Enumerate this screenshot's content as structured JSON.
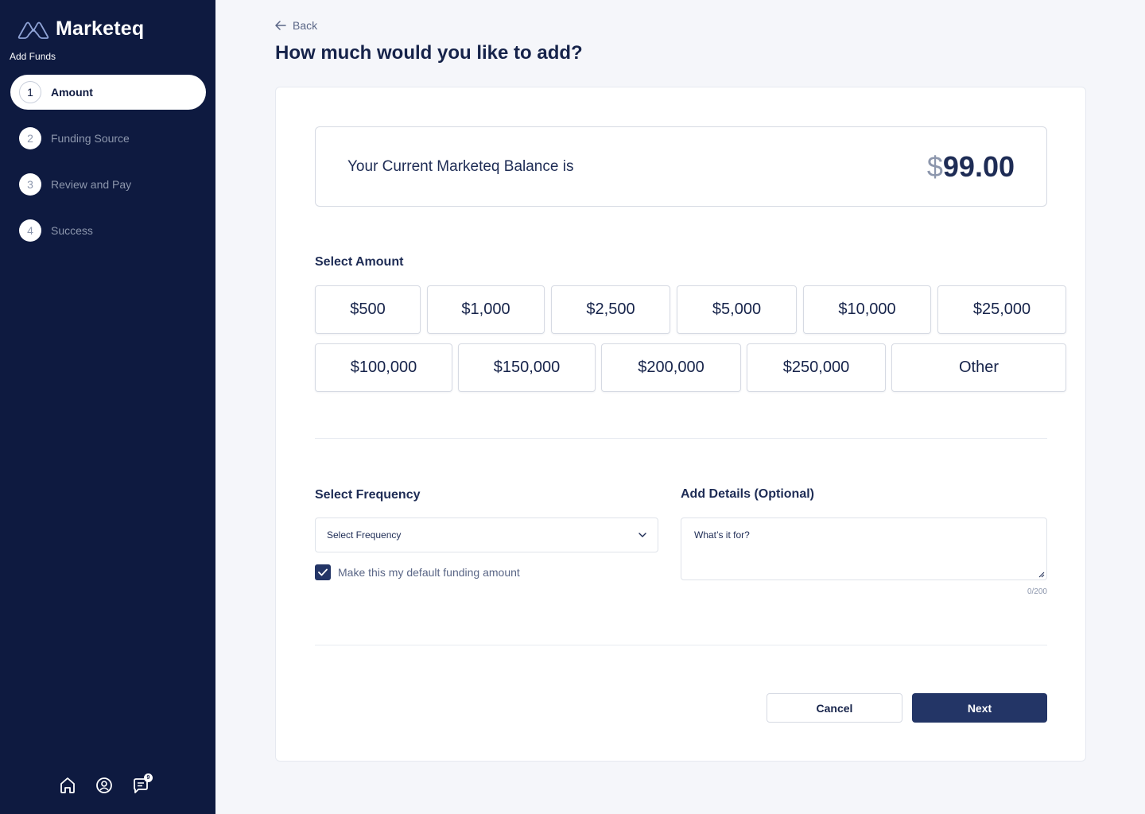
{
  "sidebar": {
    "brand": "Marketeq",
    "section_label": "Add Funds",
    "steps": [
      {
        "num": "1",
        "label": "Amount"
      },
      {
        "num": "2",
        "label": "Funding Source"
      },
      {
        "num": "3",
        "label": "Review and Pay"
      },
      {
        "num": "4",
        "label": "Success"
      }
    ],
    "messages_badge": "9"
  },
  "header": {
    "back_label": "Back",
    "title": "How much would you like to add?"
  },
  "balance": {
    "label": "Your Current Marketeq Balance is",
    "currency": "$",
    "amount": "99.00"
  },
  "amounts": {
    "label": "Select Amount",
    "row1": [
      "$500",
      "$1,000",
      "$2,500",
      "$5,000",
      "$10,000",
      "$25,000"
    ],
    "row2": [
      "$100,000",
      "$150,000",
      "$200,000",
      "$250,000",
      "Other"
    ]
  },
  "frequency": {
    "label": "Select Frequency",
    "selected": "Select Frequency",
    "default_checkbox_label": "Make this my default funding amount",
    "default_checked": true
  },
  "details": {
    "label": "Add Details (Optional)",
    "placeholder": "What’s it for?",
    "counter": "0/200"
  },
  "actions": {
    "cancel": "Cancel",
    "next": "Next"
  },
  "colors": {
    "sidebar_bg": "#0e1a40",
    "primary": "#233566",
    "text_dark": "#16234a",
    "muted": "#8d97ad"
  }
}
